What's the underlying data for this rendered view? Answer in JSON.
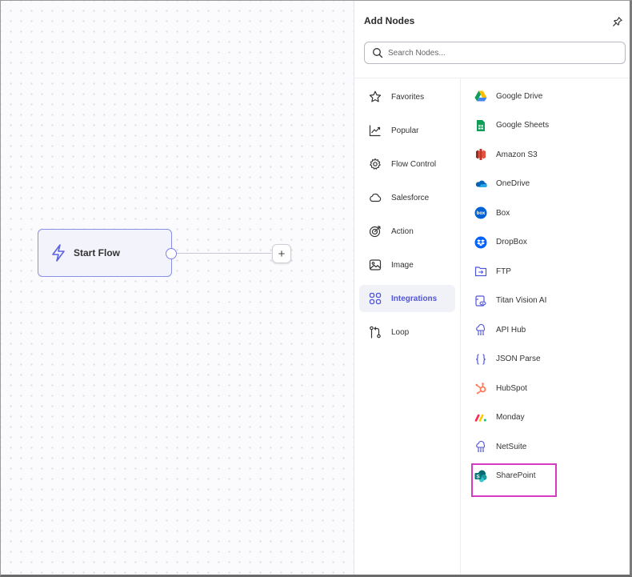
{
  "canvas": {
    "start_node": {
      "label": "Start Flow"
    },
    "add_button": {
      "label": "+"
    }
  },
  "panel": {
    "title": "Add Nodes",
    "search": {
      "placeholder": "Search Nodes...",
      "value": ""
    },
    "categories": [
      {
        "label": "Favorites",
        "icon": "star-icon"
      },
      {
        "label": "Popular",
        "icon": "trending-icon"
      },
      {
        "label": "Flow Control",
        "icon": "gear-icon"
      },
      {
        "label": "Salesforce",
        "icon": "cloud-icon"
      },
      {
        "label": "Action",
        "icon": "target-icon"
      },
      {
        "label": "Image",
        "icon": "image-icon"
      },
      {
        "label": "Integrations",
        "icon": "grid-icon",
        "active": true
      },
      {
        "label": "Loop",
        "icon": "loop-icon"
      }
    ],
    "integrations": [
      {
        "label": "Google Drive",
        "icon": "google-drive-icon"
      },
      {
        "label": "Google Sheets",
        "icon": "google-sheets-icon"
      },
      {
        "label": "Amazon S3",
        "icon": "amazon-s3-icon"
      },
      {
        "label": "OneDrive",
        "icon": "onedrive-icon"
      },
      {
        "label": "Box",
        "icon": "box-icon"
      },
      {
        "label": "DropBox",
        "icon": "dropbox-icon"
      },
      {
        "label": "FTP",
        "icon": "folder-icon"
      },
      {
        "label": "Titan Vision AI",
        "icon": "vision-icon"
      },
      {
        "label": "API Hub",
        "icon": "api-hub-icon"
      },
      {
        "label": "JSON Parse",
        "icon": "braces-icon"
      },
      {
        "label": "HubSpot",
        "icon": "hubspot-icon"
      },
      {
        "label": "Monday",
        "icon": "monday-icon"
      },
      {
        "label": "NetSuite",
        "icon": "netsuite-icon"
      },
      {
        "label": "SharePoint",
        "icon": "sharepoint-icon",
        "highlighted": true
      }
    ]
  },
  "colors": {
    "accent": "#5056d8",
    "node_border": "#8a8fe8",
    "highlight": "#d63cc1"
  }
}
